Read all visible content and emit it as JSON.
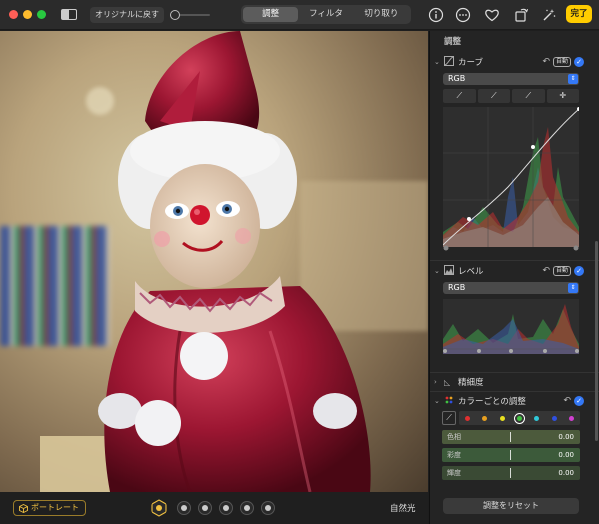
{
  "toolbar": {
    "revert_label": "オリジナルに戻す",
    "tabs": [
      {
        "label": "調整",
        "active": true
      },
      {
        "label": "フィルタ",
        "active": false
      },
      {
        "label": "切り取り",
        "active": false
      }
    ],
    "icons": [
      "info-icon",
      "more-icon",
      "heart-icon",
      "rotate-icon",
      "magic-wand-icon"
    ],
    "done_label": "完了"
  },
  "photo": {
    "subject": "clown-doll"
  },
  "bottom": {
    "portrait_label": "ポートレート",
    "lighting_count": 6,
    "lighting_label": "自然光"
  },
  "panel": {
    "title": "調整",
    "curves": {
      "label": "カーブ",
      "auto": "自動",
      "channel": "RGB",
      "tools": [
        "black-point-eyedropper",
        "gray-point-eyedropper",
        "white-point-eyedropper",
        "add-point-icon"
      ]
    },
    "levels": {
      "label": "レベル",
      "auto": "自動",
      "channel": "RGB"
    },
    "definition": {
      "label": "精細度"
    },
    "selective_color": {
      "label": "カラーごとの調整",
      "swatches": [
        "#e03030",
        "#e8a020",
        "#e8e020",
        "#40c040",
        "#30c8d8",
        "#3050e0",
        "#d040d0"
      ],
      "selected_index": 3,
      "rows": [
        {
          "label": "色相",
          "value": "0.00"
        },
        {
          "label": "彩度",
          "value": "0.00"
        },
        {
          "label": "輝度",
          "value": "0.00"
        }
      ]
    },
    "reset_label": "調整をリセット"
  },
  "colors": {
    "accent": "#3478f6",
    "done": "#ffcc00",
    "portrait": "#f0c040"
  }
}
